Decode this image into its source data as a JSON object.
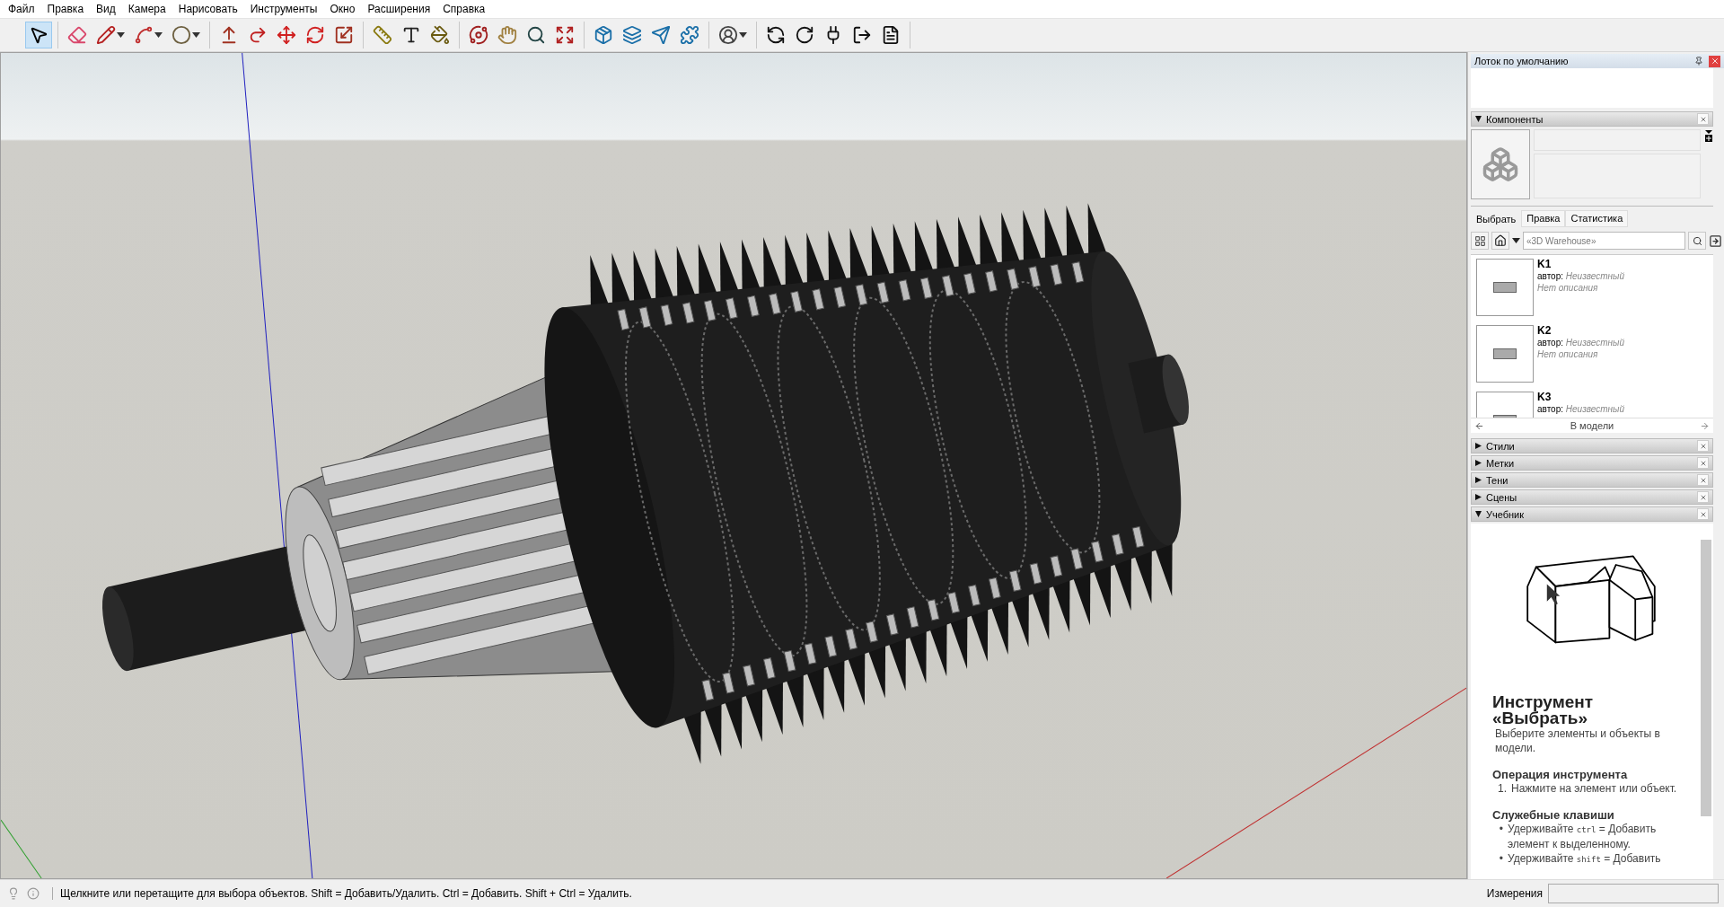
{
  "menu": [
    "Файл",
    "Правка",
    "Вид",
    "Камера",
    "Нарисовать",
    "Инструменты",
    "Окно",
    "Расширения",
    "Справка"
  ],
  "toolbar": {
    "groups": [
      [
        {
          "kind": "select",
          "selected": true,
          "dropdown": false
        }
      ],
      [
        {
          "kind": "eraser",
          "selected": false,
          "dropdown": false
        },
        {
          "kind": "pencil",
          "selected": false,
          "dropdown": true
        },
        {
          "kind": "arc",
          "selected": false,
          "dropdown": true
        },
        {
          "kind": "shape",
          "selected": false,
          "dropdown": true
        }
      ],
      [
        {
          "kind": "pushpull",
          "selected": false,
          "dropdown": false
        },
        {
          "kind": "followme",
          "selected": false,
          "dropdown": false
        },
        {
          "kind": "move",
          "selected": false,
          "dropdown": false
        },
        {
          "kind": "rotate",
          "selected": false,
          "dropdown": false
        },
        {
          "kind": "scale",
          "selected": false,
          "dropdown": false
        }
      ],
      [
        {
          "kind": "tape",
          "selected": false,
          "dropdown": false
        },
        {
          "kind": "text",
          "selected": false,
          "dropdown": false
        },
        {
          "kind": "paint",
          "selected": false,
          "dropdown": false
        }
      ],
      [
        {
          "kind": "orbit",
          "selected": false,
          "dropdown": false
        },
        {
          "kind": "pan",
          "selected": false,
          "dropdown": false
        },
        {
          "kind": "zoom",
          "selected": false,
          "dropdown": false
        },
        {
          "kind": "extents",
          "selected": false,
          "dropdown": false
        }
      ],
      [
        {
          "kind": "warehouse",
          "selected": false,
          "dropdown": false
        },
        {
          "kind": "extwarehouse",
          "selected": false,
          "dropdown": false
        },
        {
          "kind": "layout",
          "selected": false,
          "dropdown": false
        },
        {
          "kind": "extmanager",
          "selected": false,
          "dropdown": false
        }
      ],
      [
        {
          "kind": "profile",
          "selected": false,
          "dropdown": true
        }
      ],
      [
        {
          "kind": "reload",
          "selected": false,
          "dropdown": false
        },
        {
          "kind": "reloadall",
          "selected": false,
          "dropdown": false
        },
        {
          "kind": "plug",
          "selected": false,
          "dropdown": false
        },
        {
          "kind": "exit",
          "selected": false,
          "dropdown": false
        },
        {
          "kind": "document",
          "selected": false,
          "dropdown": false
        }
      ]
    ]
  },
  "tray": {
    "title": "Лоток по умолчанию"
  },
  "sections": [
    {
      "kind": "components",
      "title": "Компоненты",
      "expanded": true
    },
    {
      "title": "Стили",
      "expanded": false
    },
    {
      "title": "Метки",
      "expanded": false
    },
    {
      "title": "Тени",
      "expanded": false
    },
    {
      "title": "Сцены",
      "expanded": false
    },
    {
      "kind": "instructor",
      "title": "Учебник",
      "expanded": true
    }
  ],
  "components": {
    "tabs": [
      {
        "label": "Выбрать",
        "selected": true
      },
      {
        "label": "Правка",
        "selected": false
      },
      {
        "label": "Статистика",
        "selected": false
      }
    ],
    "search": {
      "placeholder": "«3D Warehouse»"
    },
    "items": [
      {
        "name": "K1",
        "author_label": "автор:",
        "author": "Неизвестный",
        "description": "Нет описания"
      },
      {
        "name": "K2",
        "author_label": "автор:",
        "author": "Неизвестный",
        "description": "Нет описания"
      },
      {
        "name": "K3",
        "author_label": "автор:",
        "author": "Неизвестный"
      }
    ],
    "footer": "В модели"
  },
  "instructor": {
    "title": "Инструмент «Выбрать»",
    "intro": "Выберите элементы и объекты в модели.",
    "sections": [
      {
        "kind": "numbered",
        "heading": "Операция инструмента",
        "items": [
          {
            "marker": "1.",
            "before": "Нажмите на элемент или объект."
          }
        ]
      },
      {
        "kind": "bullets",
        "heading": "Служебные клавиши",
        "items": [
          {
            "marker": "•",
            "before": "Удерживайте",
            "key": "ctrl",
            "after": "= Добавить элемент к выделенному."
          },
          {
            "marker": "•",
            "before": "Удерживайте",
            "key": "shift",
            "after": "= Добавить"
          }
        ]
      }
    ]
  },
  "status_bar": {
    "message": "Щелкните или перетащите для выбора объектов. Shift = Добавить/Удалить. Ctrl = Добавить. Shift + Ctrl = Удалить.",
    "measurements_label": "Измерения"
  }
}
